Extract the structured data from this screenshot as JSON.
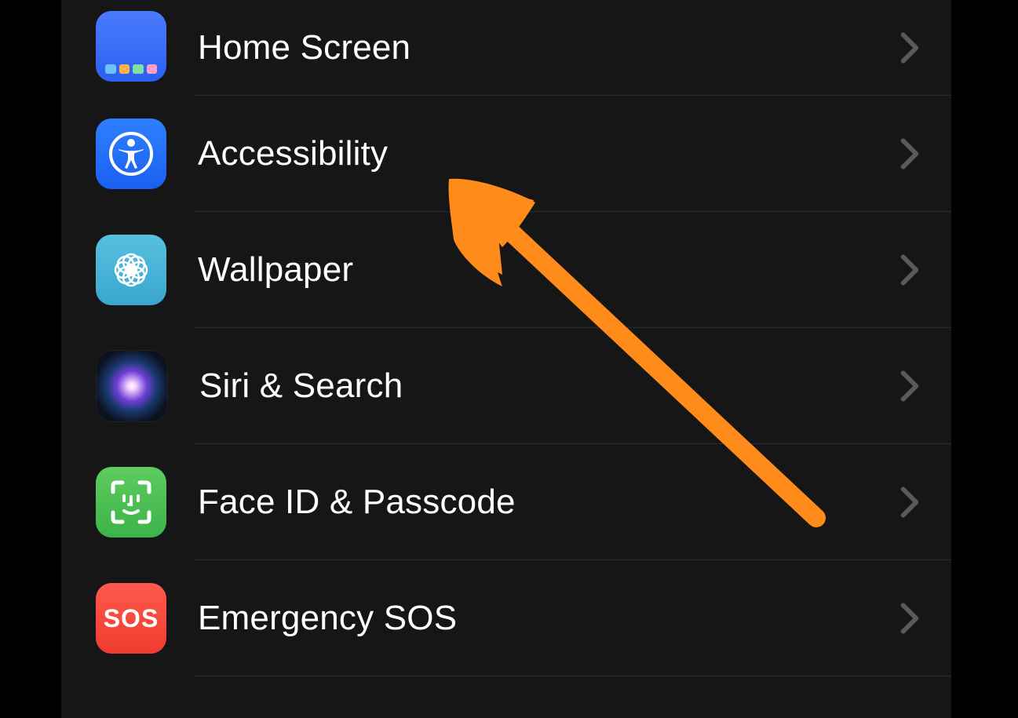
{
  "settings": {
    "items": [
      {
        "id": "home-screen",
        "label": "Home Screen",
        "icon": "home-screen-icon"
      },
      {
        "id": "accessibility",
        "label": "Accessibility",
        "icon": "accessibility-icon"
      },
      {
        "id": "wallpaper",
        "label": "Wallpaper",
        "icon": "wallpaper-icon"
      },
      {
        "id": "siri-search",
        "label": "Siri & Search",
        "icon": "siri-icon"
      },
      {
        "id": "faceid",
        "label": "Face ID & Passcode",
        "icon": "faceid-icon"
      },
      {
        "id": "sos",
        "label": "Emergency SOS",
        "icon": "sos-icon"
      }
    ]
  },
  "annotation": {
    "arrow_color": "#ff8c1a",
    "points_to": "accessibility"
  },
  "icon_sos_text": "SOS"
}
